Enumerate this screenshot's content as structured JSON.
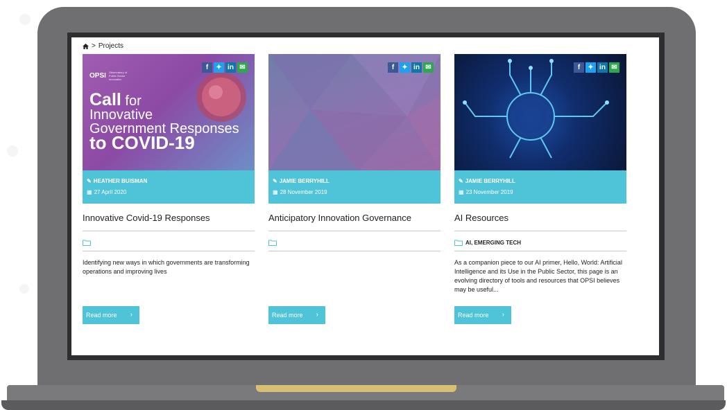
{
  "breadcrumb": {
    "home_icon": "home-icon",
    "separator": ">",
    "current": "Projects"
  },
  "share_buttons": [
    {
      "icon": "facebook-icon",
      "glyph": "f",
      "color": "#3b5998"
    },
    {
      "icon": "twitter-icon",
      "glyph": "t",
      "color": "#1da1f2"
    },
    {
      "icon": "linkedin-icon",
      "glyph": "in",
      "color": "#0e76a8"
    },
    {
      "icon": "email-icon",
      "glyph": "✉",
      "color": "#2ea84f"
    }
  ],
  "cards": [
    {
      "image": {
        "logo_text": "OPSI",
        "logo_sub": "Observatory of Public Sector Innovation",
        "headline_call": "Call",
        "headline_for": "for",
        "headline_lines": [
          "Innovative",
          "Government Responses",
          "to COVID-19"
        ]
      },
      "author": "HEATHER BUISMAN",
      "date": "27 April 2020",
      "title": "Innovative Covid-19 Responses",
      "category": "",
      "excerpt": "Identifying new ways in which governments are transforming operations and improving lives",
      "read_more": "Read more"
    },
    {
      "image": {},
      "author": "JAMIE BERRYHILL",
      "date": "28 November 2019",
      "title": "Anticipatory Innovation Governance",
      "category": "",
      "excerpt": "",
      "read_more": "Read more"
    },
    {
      "image": {},
      "author": "JAMIE BERRYHILL",
      "date": "23 November 2019",
      "title": "AI Resources",
      "category": "AI, EMERGING TECH",
      "excerpt": "As a companion piece to our AI primer, Hello, World: Artificial Intelligence and its Use in the Public Sector, this page is an evolving directory of tools and resources that OPSI believes may be useful...",
      "read_more": "Read more"
    }
  ],
  "colors": {
    "accent": "#4fc3d8",
    "laptop_body": "#6f6f72",
    "bezel": "#2e2e30",
    "hinge_notch": "#d8bf74"
  }
}
